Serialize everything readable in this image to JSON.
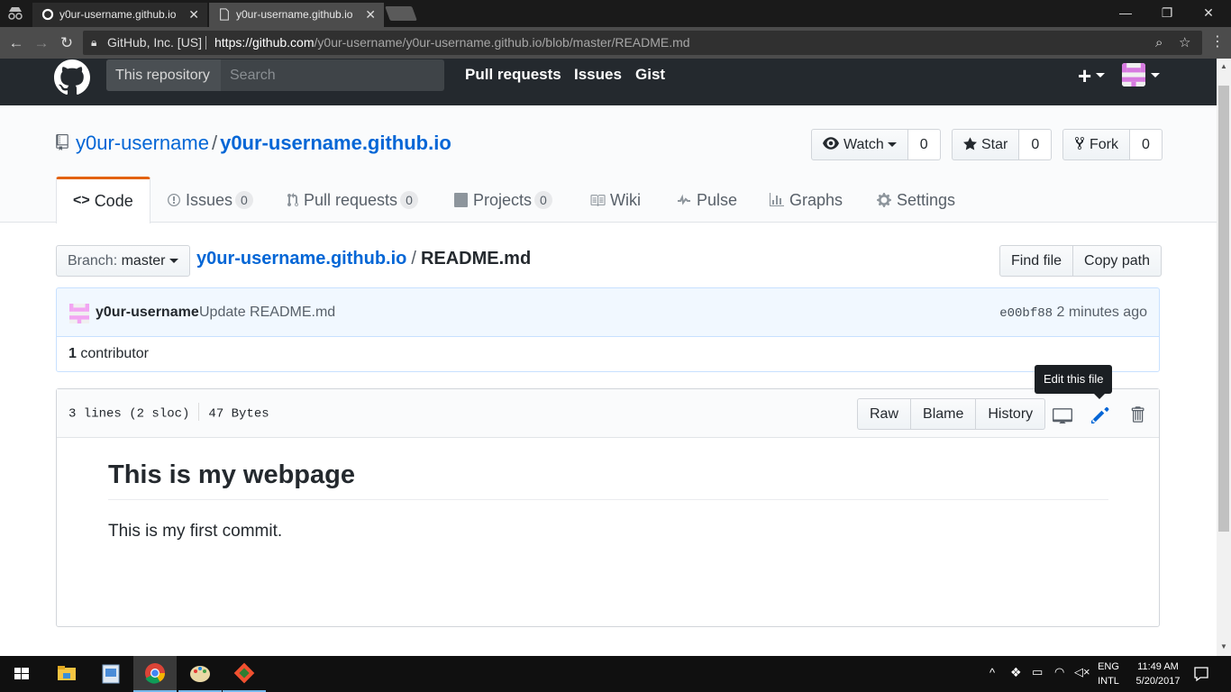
{
  "browser": {
    "tabs": [
      {
        "title": "y0ur-username.github.io",
        "active": false
      },
      {
        "title": "y0ur-username.github.io",
        "active": true
      }
    ],
    "secure_label": "GitHub, Inc. [US]",
    "url_scheme_host": "https://github.com",
    "url_path": "/y0ur-username/y0ur-username.github.io/blob/master/README.md"
  },
  "github_header": {
    "scope_label": "This repository",
    "search_placeholder": "Search",
    "nav": [
      "Pull requests",
      "Issues",
      "Gist"
    ],
    "plus": "+"
  },
  "repo": {
    "owner": "y0ur-username",
    "separator": "/",
    "name": "y0ur-username.github.io",
    "watch_label": "Watch",
    "watch_count": "0",
    "star_label": "Star",
    "star_count": "0",
    "fork_label": "Fork",
    "fork_count": "0"
  },
  "reponav": {
    "code": "Code",
    "issues": "Issues",
    "issues_count": "0",
    "pulls": "Pull requests",
    "pulls_count": "0",
    "projects": "Projects",
    "projects_count": "0",
    "wiki": "Wiki",
    "pulse": "Pulse",
    "graphs": "Graphs",
    "settings": "Settings"
  },
  "file_nav": {
    "branch_label": "Branch:",
    "branch_name": "master",
    "breadcrumb_root": "y0ur-username.github.io",
    "breadcrumb_sep": "/",
    "breadcrumb_file": "README.md",
    "find_file": "Find file",
    "copy_path": "Copy path"
  },
  "commit": {
    "author": "y0ur-username",
    "message": "Update README.md",
    "sha": "e00bf88",
    "time": "2 minutes ago",
    "contributors_count": "1",
    "contributors_label": "contributor"
  },
  "file": {
    "lines": "3 lines (2 sloc)",
    "size": "47 Bytes",
    "raw": "Raw",
    "blame": "Blame",
    "history": "History",
    "tooltip": "Edit this file"
  },
  "readme": {
    "heading": "This is my webpage",
    "paragraph": "This is my first commit."
  },
  "taskbar": {
    "lang_top": "ENG",
    "lang_bottom": "INTL",
    "time": "11:49 AM",
    "date": "5/20/2017"
  },
  "colors": {
    "gh_header": "#24292e",
    "link": "#0366d6",
    "selected_tab_accent": "#e36209"
  }
}
